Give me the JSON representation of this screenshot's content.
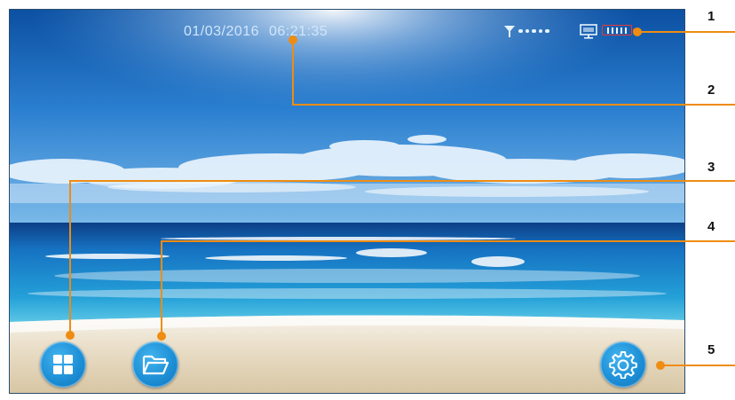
{
  "status": {
    "date": "01/03/2016",
    "time": "06:21:35",
    "signal_icon": "antenna-icon",
    "signal_dots": 5,
    "display_icon": "monitor-icon",
    "battery_icon": "battery-icon",
    "battery_level": 1.0
  },
  "dock": {
    "apps_button_icon": "grid-icon",
    "files_button_icon": "folder-icon",
    "settings_button_icon": "gear-icon"
  },
  "callouts": [
    {
      "number": "1"
    },
    {
      "number": "2"
    },
    {
      "number": "3"
    },
    {
      "number": "4"
    },
    {
      "number": "5"
    }
  ],
  "colors": {
    "callout_line": "#ef8c12",
    "button_blue": "#1d8fd6",
    "battery_border": "#e53a3a",
    "sky_top": "#0d57a9",
    "sea": "#1a8fcf",
    "sand": "#efe6d2"
  }
}
